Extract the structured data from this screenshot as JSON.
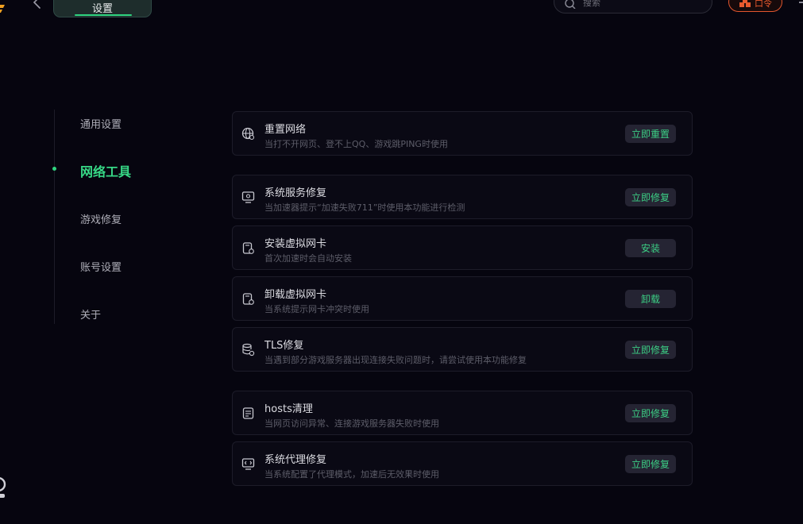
{
  "header": {
    "title": "设置",
    "search_placeholder": "搜索",
    "badge_label": "口令"
  },
  "sidebar": {
    "items": [
      {
        "label": "通用设置",
        "active": false
      },
      {
        "label": "网络工具",
        "active": true
      },
      {
        "label": "游戏修复",
        "active": false
      },
      {
        "label": "账号设置",
        "active": false
      },
      {
        "label": "关于",
        "active": false
      }
    ]
  },
  "tools": [
    {
      "icon": "globe-gear-icon",
      "title": "重置网络",
      "desc": "当打不开网页、登不上QQ、游戏跳PING时使用",
      "button": "立即重置"
    },
    {
      "icon": "monitor-service-icon",
      "title": "系统服务修复",
      "desc": "当加速器提示“加速失败711”时使用本功能进行检测",
      "button": "立即修复"
    },
    {
      "icon": "network-card-install-icon",
      "title": "安装虚拟网卡",
      "desc": "首次加速时会自动安装",
      "button": "安装"
    },
    {
      "icon": "network-card-uninstall-icon",
      "title": "卸载虚拟网卡",
      "desc": "当系统提示网卡冲突时使用",
      "button": "卸载"
    },
    {
      "icon": "database-gear-icon",
      "title": "TLS修复",
      "desc": "当遇到部分游戏服务器出现连接失败问题时，请尝试使用本功能修复",
      "button": "立即修复"
    },
    {
      "icon": "hosts-file-icon",
      "title": "hosts清理",
      "desc": "当网页访问异常、连接游戏服务器失败时使用",
      "button": "立即修复"
    },
    {
      "icon": "proxy-monitor-icon",
      "title": "系统代理修复",
      "desc": "当系统配置了代理模式，加速后无效果时使用",
      "button": "立即修复"
    }
  ],
  "colors": {
    "accent": "#2fd47f",
    "background": "#06050f",
    "card": "#0a0914",
    "badge": "#e2562e"
  }
}
